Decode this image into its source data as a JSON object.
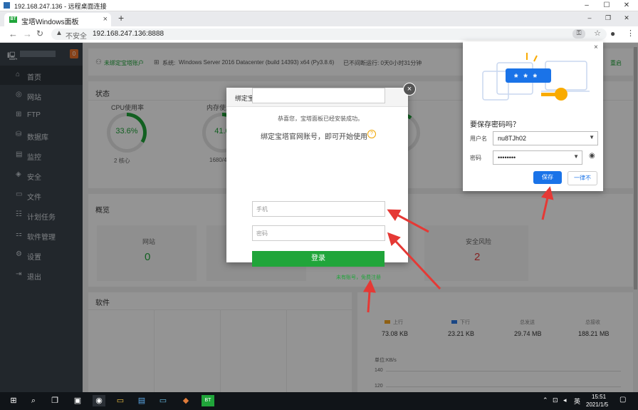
{
  "rdp": {
    "title": "192.168.247.136 - 远程桌面连接",
    "minimize": "–",
    "maximize": "☐",
    "close": "✕"
  },
  "browser": {
    "tab_title": "宝塔Windows面板",
    "tab_favicon": "BT",
    "tab_close": "×",
    "new_tab": "+",
    "not_secure": "不安全",
    "url": "192.168.247.136:8888"
  },
  "sidebar": {
    "counter": "0",
    "items": [
      {
        "icon": "⌂",
        "label": "首页"
      },
      {
        "icon": "◎",
        "label": "网站"
      },
      {
        "icon": "⊞",
        "label": "FTP"
      },
      {
        "icon": "⛁",
        "label": "数据库"
      },
      {
        "icon": "▤",
        "label": "监控"
      },
      {
        "icon": "◈",
        "label": "安全"
      },
      {
        "icon": "▭",
        "label": "文件"
      },
      {
        "icon": "☷",
        "label": "计划任务"
      },
      {
        "icon": "⚏",
        "label": "软件管理"
      },
      {
        "icon": "⚙",
        "label": "设置"
      },
      {
        "icon": "⇥",
        "label": "退出"
      }
    ]
  },
  "top_info": {
    "bind_user": "未绑定宝塔账户",
    "system_label": "系统:",
    "system": "Windows Server 2016 Datacenter (build 14393) x64 (Py3.8.6)",
    "uptime": "已不间断运行: 0天0小时31分钟",
    "right_link": "重启"
  },
  "status": {
    "heading": "状态",
    "gauges": [
      {
        "label": "CPU使用率",
        "value": "33.6%",
        "sub": "2 核心",
        "fill": 0.336
      },
      {
        "label": "内存使用率",
        "value": "41.0",
        "sub": "1680/409",
        "fill": 0.41
      },
      {
        "label": "C:/",
        "value": "",
        "sub": "",
        "fill": 0.3
      },
      {
        "label": "D:/",
        "value": "",
        "sub": "0.00 GB",
        "fill": 0.1
      }
    ]
  },
  "overview": {
    "heading": "概览",
    "site_label": "网站",
    "site_value": "0",
    "risk_label": "安全风险",
    "risk_value": "2"
  },
  "software": {
    "heading": "软件"
  },
  "traffic": {
    "up_label": "上行",
    "up_value": "73.08 KB",
    "down_label": "下行",
    "down_value": "23.21 KB",
    "total_send_label": "总发送",
    "total_send": "29.74 MB",
    "total_recv_label": "总接收",
    "total_recv": "188.21 MB",
    "unit": "单位:KB/s",
    "tick_140": "140",
    "tick_120": "120"
  },
  "modal": {
    "title": "绑定宝塔官网账号",
    "congrats": "恭喜您，宝塔面板已经安装成功。",
    "subtitle": "绑定宝塔官网账号，即可开始使用",
    "phone_placeholder": "手机",
    "password_placeholder": "密码",
    "login": "登录",
    "register_link": "未有账号，免费注册",
    "close": "×",
    "help": "?"
  },
  "pw_popup": {
    "question": "要保存密码吗？",
    "username_label": "用户名",
    "username": "nu8TJh02",
    "password_label": "密码",
    "password": "••••••••",
    "save": "保存",
    "never": "一律不",
    "close": "×",
    "stars": "* * *"
  },
  "taskbar": {
    "time": "15:51",
    "date": "2021/1/5",
    "ime": "英"
  },
  "colors": {
    "accent": "#20a53a",
    "sidebar": "#3c444d",
    "save_blue": "#1a73e8",
    "risk": "#e33b3b",
    "arrow": "#e53935"
  }
}
